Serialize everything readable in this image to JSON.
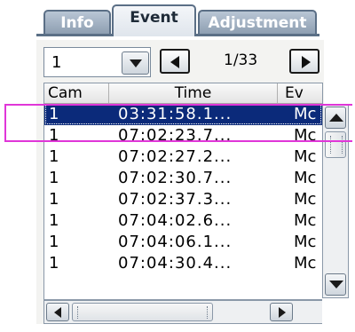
{
  "tabs": [
    {
      "label": "Info",
      "active": false
    },
    {
      "label": "Event",
      "active": true
    },
    {
      "label": "Adjustment",
      "active": false
    }
  ],
  "controls": {
    "camera_select_value": "1",
    "page_indicator": "1/33"
  },
  "table": {
    "columns": [
      "Cam",
      "Time",
      "Ev"
    ],
    "rows": [
      {
        "cam": "1",
        "time": "03:31:58.1...",
        "event": "Mc",
        "selected": true
      },
      {
        "cam": "1",
        "time": "07:02:23.7...",
        "event": "Mc"
      },
      {
        "cam": "1",
        "time": "07:02:27.2...",
        "event": "Mc"
      },
      {
        "cam": "1",
        "time": "07:02:30.7...",
        "event": "Mc"
      },
      {
        "cam": "1",
        "time": "07:02:37.3...",
        "event": "Mc"
      },
      {
        "cam": "1",
        "time": "07:04:02.6...",
        "event": "Mc"
      },
      {
        "cam": "1",
        "time": "07:04:06.1...",
        "event": "Mc"
      },
      {
        "cam": "1",
        "time": "07:04:30.4...",
        "event": "Mc"
      }
    ]
  },
  "colors": {
    "selection": "#0b2a7a",
    "highlight": "#e036d8",
    "tab_border": "#5b6f86"
  }
}
